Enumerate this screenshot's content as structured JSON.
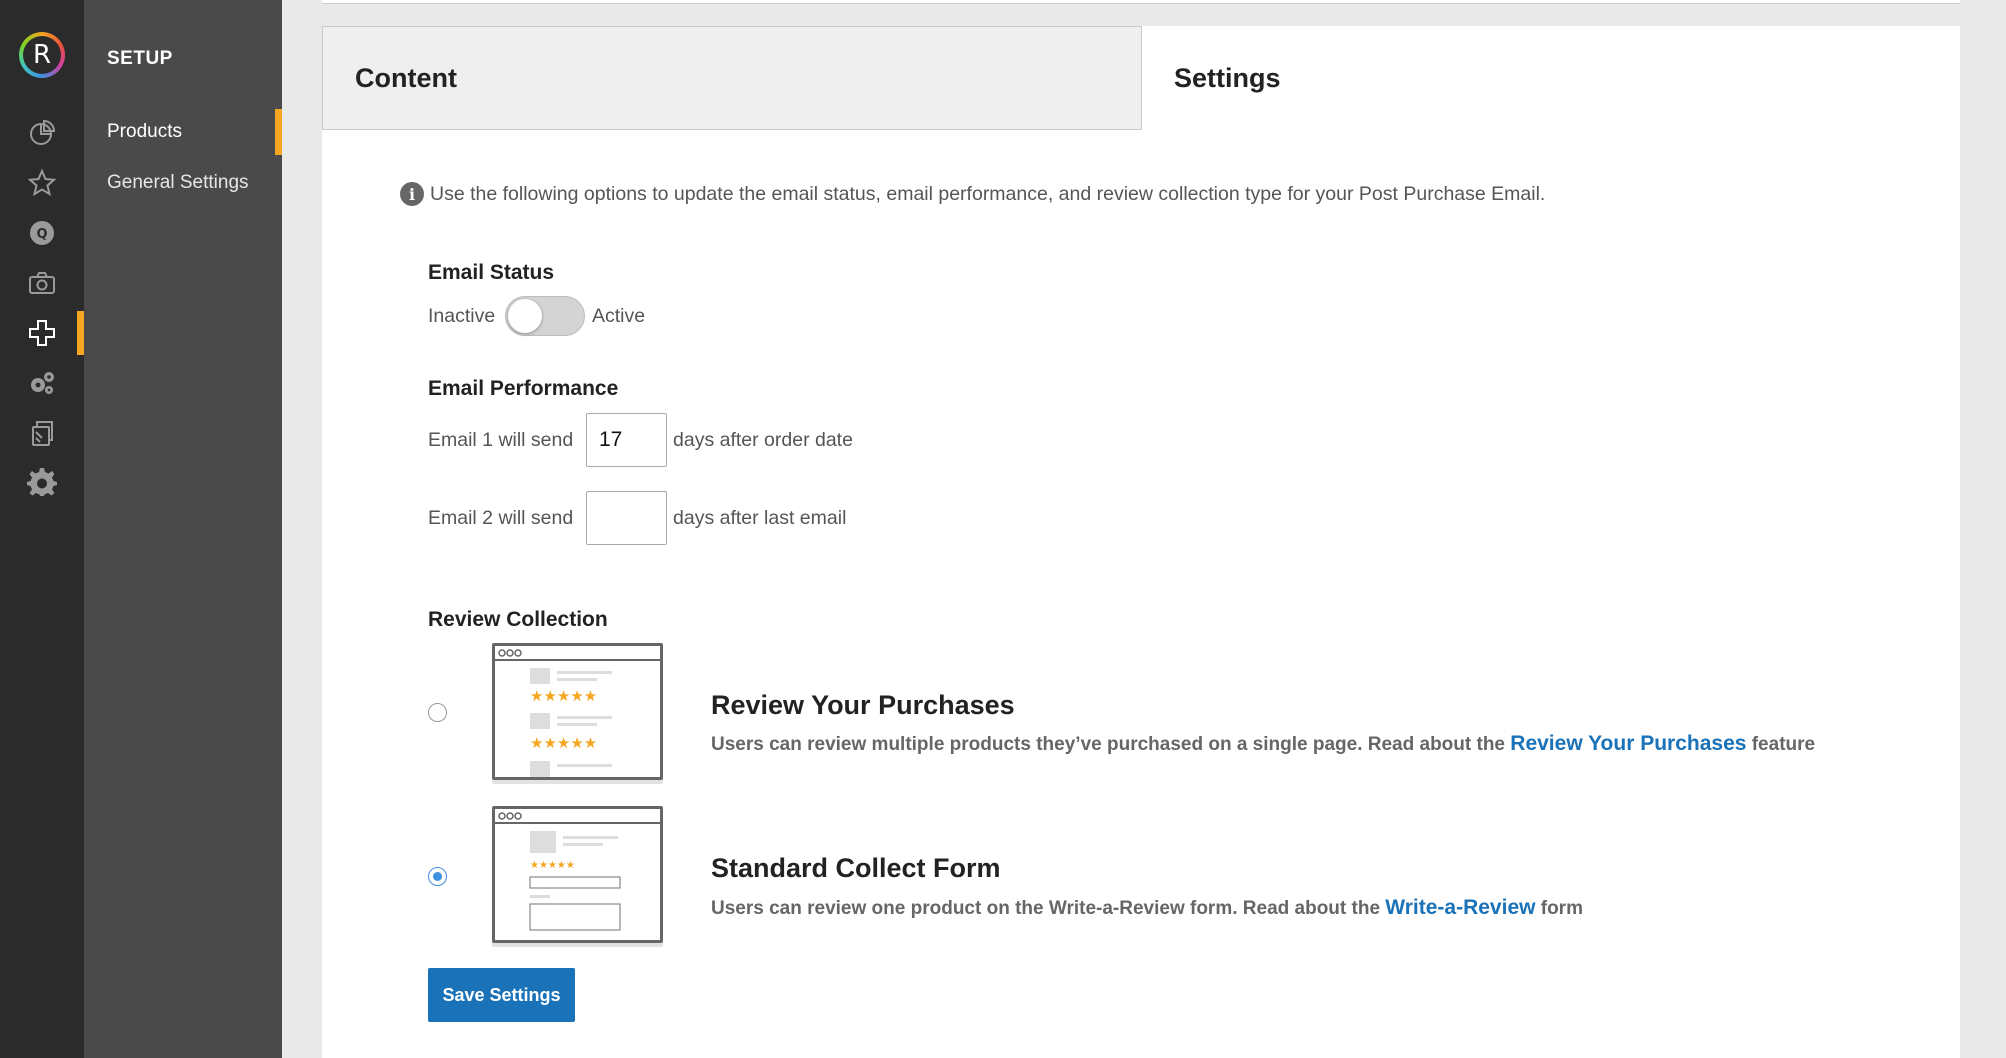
{
  "rail": {
    "logo_letter": "R",
    "icons": [
      "pie-chart-icon",
      "star-icon",
      "q-badge-icon",
      "camera-icon",
      "puzzle-plus-icon",
      "gears-icon",
      "pages-icon",
      "gear-icon"
    ],
    "active_icon": "puzzle-plus-icon"
  },
  "subnav": {
    "title": "SETUP",
    "items": [
      {
        "label": "Products",
        "active": true
      },
      {
        "label": "General Settings",
        "active": false
      }
    ]
  },
  "tabs": [
    {
      "label": "Content",
      "active": false
    },
    {
      "label": "Settings",
      "active": true
    }
  ],
  "info_text": "Use the following options to update the email status, email performance, and review collection type for your Post Purchase Email.",
  "email_status": {
    "title": "Email Status",
    "off_label": "Inactive",
    "on_label": "Active",
    "is_active": false
  },
  "email_performance": {
    "title": "Email Performance",
    "email1": {
      "prefix": "Email 1 will send",
      "value": "17",
      "suffix": "days after order date"
    },
    "email2": {
      "prefix": "Email 2 will send",
      "value": "",
      "suffix": "days after last email"
    }
  },
  "review_collection": {
    "title": "Review Collection",
    "options": [
      {
        "title": "Review Your Purchases",
        "desc_before": "Users can review multiple products they’ve purchased on a single page. Read about the",
        "link": "Review Your Purchases",
        "desc_after": "feature",
        "selected": false
      },
      {
        "title": "Standard Collect Form",
        "desc_before": "Users can review one product on the Write-a-Review form. Read about the",
        "link": "Write-a-Review",
        "desc_after": "form",
        "selected": true
      }
    ]
  },
  "save_label": "Save Settings",
  "colors": {
    "accent": "#f5a623",
    "link": "#1a72b8",
    "radio_selected": "#3f8fe0",
    "rail_bg": "#2b2b2b",
    "subnav_bg": "#4a4a4a"
  }
}
